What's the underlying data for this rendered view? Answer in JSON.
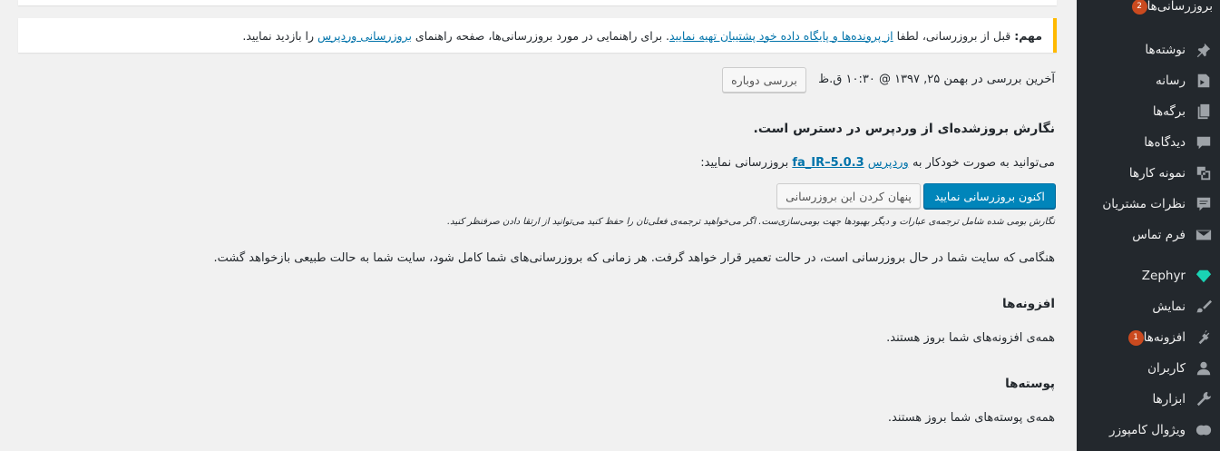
{
  "notice": {
    "prefix": "مهم:",
    "text1": "قبل از بروزرسانی، لطفا",
    "link1": "از پرونده‌ها و پایگاه داده خود پشتیبان تهیه نمایید",
    "text2": ". برای راهنمایی در مورد بروزرسانی‌ها، صفحه راهنمای",
    "link2": "بروزرسانی وردپرس",
    "text3": "را بازدید نمایید."
  },
  "last_check": "آخرین بررسی در بهمن ۲۵, ۱۳۹۷ @ ۱۰:۳۰ ق.ظ",
  "recheck_button": "بررسی دوباره",
  "core": {
    "heading": "نگارش بروزشده‌ای از وردپرس در دسترس است.",
    "text_before": "می‌توانید به صورت خودکار به",
    "wp_link": "وردپرس",
    "version": "fa_IR–5.0.3",
    "text_after": "بروزرسانی نمایید:",
    "update_button": "اکنون بروزرسانی نمایید",
    "hide_button": "پنهان کردن این بروزرسانی",
    "note": "نگارش بومی شده شامل ترجمه‌ی عبارات و دیگر بهبودها جهت بومی‌سازی‌ست. اگر می‌خواهید ترجمه‌ی فعلی‌تان را حفظ کنید می‌توانید از ارتقا دادن صرفنظر کنید.",
    "maintenance": "هنگامی که سایت شما در حال بروزرسانی است، در حالت تعمیر قرار خواهد گرفت. هر زمانی که بروزرسانی‌های شما کامل شود، سایت شما به حالت طبیعی بازخواهد گشت."
  },
  "plugins": {
    "heading": "افزونه‌ها",
    "text": "همه‌ی افزونه‌های شما بروز هستند."
  },
  "themes": {
    "heading": "پوسته‌ها",
    "text": "همه‌ی پوسته‌های شما بروز هستند."
  },
  "sidebar": {
    "items": [
      {
        "label": "بروزرسانی‌ها",
        "count": "2",
        "icon": "updates-icon"
      },
      {
        "label": "نوشته‌ها",
        "icon": "pin-icon"
      },
      {
        "label": "رسانه",
        "icon": "media-icon"
      },
      {
        "label": "برگه‌ها",
        "icon": "pages-icon"
      },
      {
        "label": "دیدگاه‌ها",
        "icon": "comment-icon"
      },
      {
        "label": "نمونه کارها",
        "icon": "portfolio-icon"
      },
      {
        "label": "نظرات مشتریان",
        "icon": "testimonial-icon"
      },
      {
        "label": "فرم تماس",
        "icon": "mail-icon"
      },
      {
        "label": "Zephyr",
        "icon": "diamond-icon"
      },
      {
        "label": "نمایش",
        "icon": "brush-icon"
      },
      {
        "label": "افزونه‌ها",
        "count": "1",
        "icon": "plugin-icon"
      },
      {
        "label": "کاربران",
        "icon": "user-icon"
      },
      {
        "label": "ابزارها",
        "icon": "wrench-icon"
      },
      {
        "label": "ویژوال کامپوزر",
        "icon": "composer-icon"
      }
    ]
  },
  "colors": {
    "accent": "#0085ba",
    "warning": "#ffb900",
    "sidebar": "#23282d",
    "badge": "#ca4a1f",
    "zephyr": "#1ad3b4"
  }
}
